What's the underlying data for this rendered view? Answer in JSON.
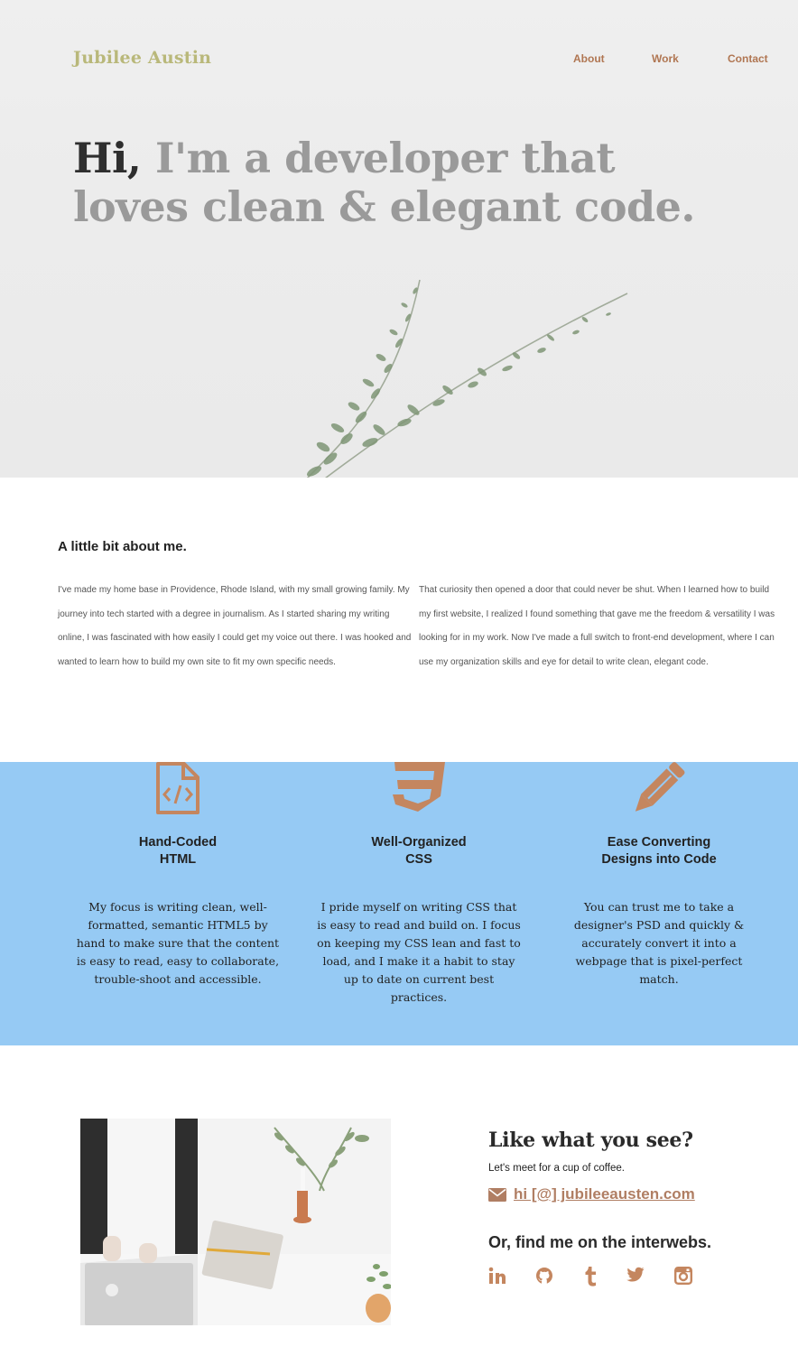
{
  "header": {
    "brand": "Jubilee Austin",
    "nav": [
      "About",
      "Work",
      "Contact"
    ]
  },
  "hero": {
    "greeting": "Hi,",
    "headline_rest": " I'm a developer that loves clean & elegant code."
  },
  "about": {
    "title": "A little bit about me.",
    "col1": "I've made my home base in Providence, Rhode Island, with my small growing family. My journey into tech started with a degree in journalism. As I started sharing my writing online, I was fascinated with how easily I could get my voice out there. I was hooked and wanted to learn how to build my own site to fit my own specific needs.",
    "col2": "That curiosity then opened a door that could never be shut. When I learned how to build my first website, I realized I found something that gave me the freedom & versatility I was looking for in my work. Now I've made a full switch to front-end development, where I can use my organization skills and eye for detail to write clean, elegant code."
  },
  "skills": [
    {
      "icon": "html-file-icon",
      "title_line1": "Hand-Coded",
      "title_line2": "HTML",
      "text": "My focus is writing clean, well-formatted, semantic HTML5 by hand to make sure that the content is easy to read, easy to collaborate, trouble-shoot and accessible."
    },
    {
      "icon": "css3-icon",
      "title_line1": "Well-Organized",
      "title_line2": "CSS",
      "text": "I pride myself on writing CSS that is easy to read and build on. I focus on keeping my CSS lean and fast to load, and I make it a habit to stay up to date on current best practices."
    },
    {
      "icon": "pencil-icon",
      "title_line1": "Ease Converting",
      "title_line2": "Designs into Code",
      "text": "You can trust me to take a designer's PSD and quickly & accurately convert it into a webpage that is pixel-perfect match."
    }
  ],
  "contact": {
    "title": "Like what you see?",
    "subtitle": "Let's meet for a cup of coffee.",
    "email": "hi [@] jubileeausten.com",
    "social_title": "Or, find me on the interwebs.",
    "socials": [
      "linkedin-icon",
      "github-icon",
      "tumblr-icon",
      "twitter-icon",
      "instagram-icon"
    ]
  },
  "colors": {
    "brand": "#b9b87a",
    "accent": "#b07652",
    "skills_bg": "#96caf4"
  }
}
